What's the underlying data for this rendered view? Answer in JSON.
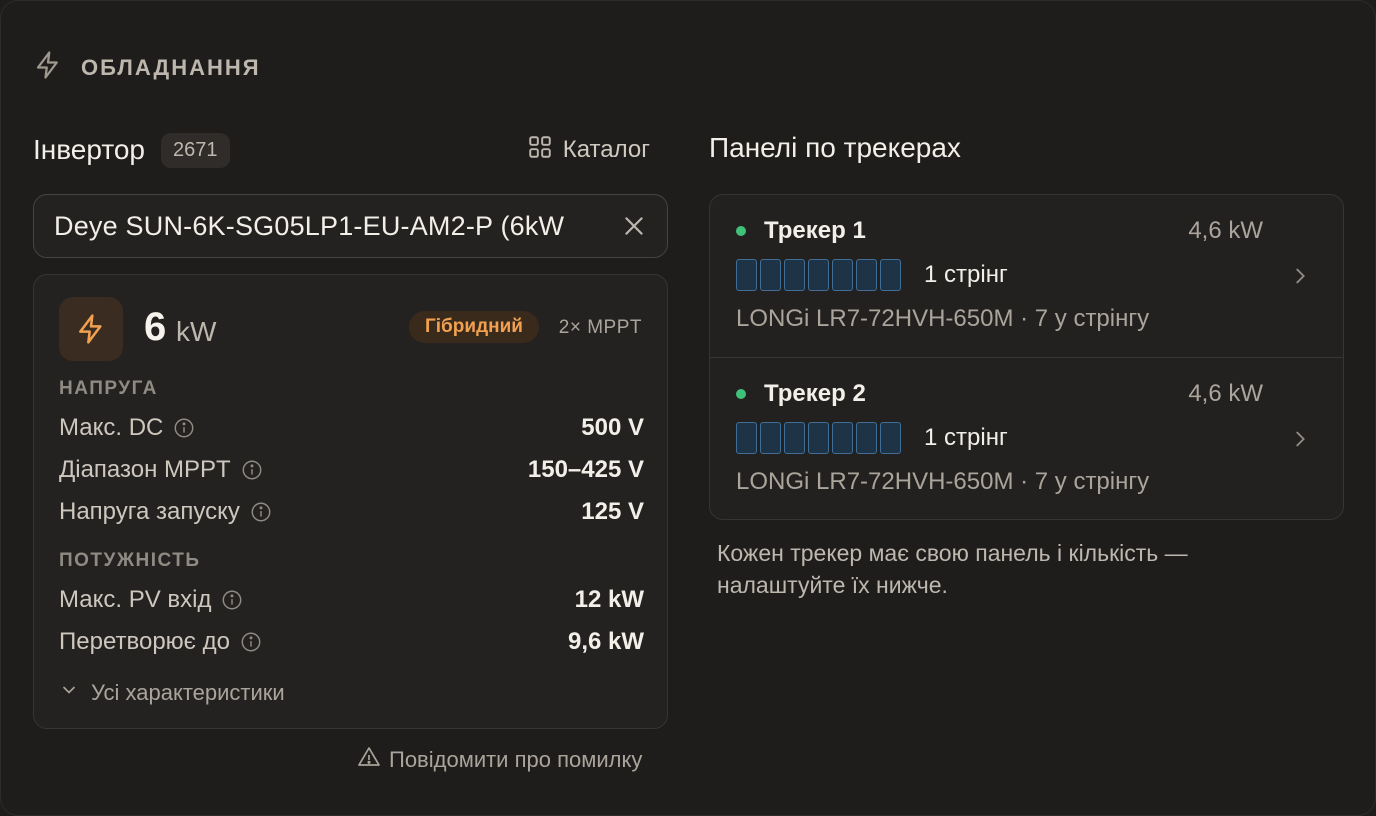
{
  "section": {
    "title": "ОБЛАДНАННЯ",
    "icon": "lightning-icon"
  },
  "inverter": {
    "title": "Інвертор",
    "count": "2671",
    "catalog_label": "Каталог",
    "selected": "Deye SUN-6K-SG05LP1-EU-AM2-P (6kW",
    "power_value": "6",
    "power_unit": "kW",
    "type_badge": "Гібридний",
    "mppt": "2× MPPT",
    "voltage_group": "НАПРУГА",
    "voltage_rows": [
      {
        "label": "Макс. DC",
        "value": "500 V"
      },
      {
        "label": "Діапазон MPPT",
        "value": "150–425 V"
      },
      {
        "label": "Напруга запуску",
        "value": "125 V"
      }
    ],
    "power_group": "ПОТУЖНІСТЬ",
    "power_rows": [
      {
        "label": "Макс. PV вхід",
        "value": "12 kW"
      },
      {
        "label": "Перетворює до",
        "value": "9,6 kW"
      }
    ],
    "all_specs_label": "Усі характеристики"
  },
  "report_label": "Повідомити про помилку",
  "panels": {
    "title": "Панелі по трекерах",
    "trackers": [
      {
        "name": "Трекер 1",
        "power": "4,6 kW",
        "panels_per_string": 7,
        "strings": "1 стрінг",
        "panel": "LONGi LR7-72HVH-650M · 7 у стрінгу"
      },
      {
        "name": "Трекер 2",
        "power": "4,6 kW",
        "panels_per_string": 7,
        "strings": "1 стрінг",
        "panel": "LONGi LR7-72HVH-650M · 7 у стрінгу"
      }
    ],
    "note": "Кожен трекер має свою панель і кількість — налаштуйте їх нижче."
  },
  "colors": {
    "accent": "#f0a050",
    "status_dot": "#3ec27a",
    "panel_cell": "#3f6f99"
  }
}
